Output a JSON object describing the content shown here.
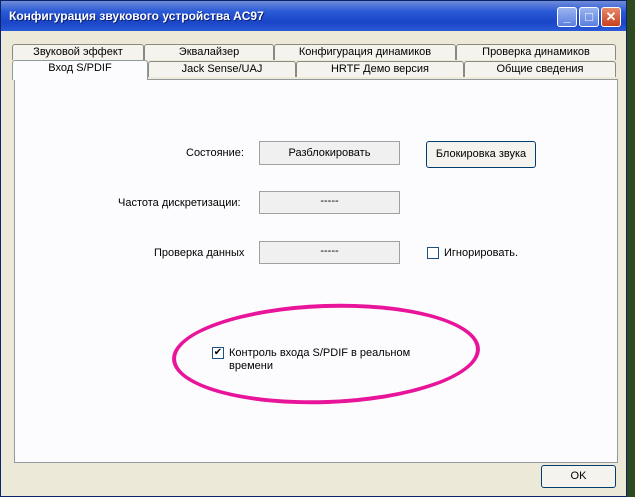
{
  "window": {
    "title": "Конфигурация звукового устройства AC97"
  },
  "tabs_back": [
    "Звуковой эффект",
    "Эквалайзер",
    "Конфигурация динамиков",
    "Проверка динамиков"
  ],
  "tabs_front": [
    "Вход S/PDIF",
    "Jack Sense/UAJ",
    "HRTF Демо версия",
    "Общие сведения"
  ],
  "active_tab": "Вход S/PDIF",
  "panel": {
    "status_label": "Состояние:",
    "status_value": "Разблокировать",
    "lock_button": "Блокировка звука",
    "rate_label": "Частота дискретизации:",
    "rate_value": "-----",
    "check_label": "Проверка данных",
    "check_value": "-----",
    "ignore_label": "Игнорировать.",
    "ignore_checked": false,
    "monitor_line1": "Контроль входа S/PDIF в реальном",
    "monitor_line2": "времени",
    "monitor_checked": true,
    "check_mark": "✔"
  },
  "ok_button": "OK",
  "colors": {
    "titlebar": "#2a5ad6",
    "annotation": "#e8149a",
    "panel": "#fcfcfe"
  }
}
